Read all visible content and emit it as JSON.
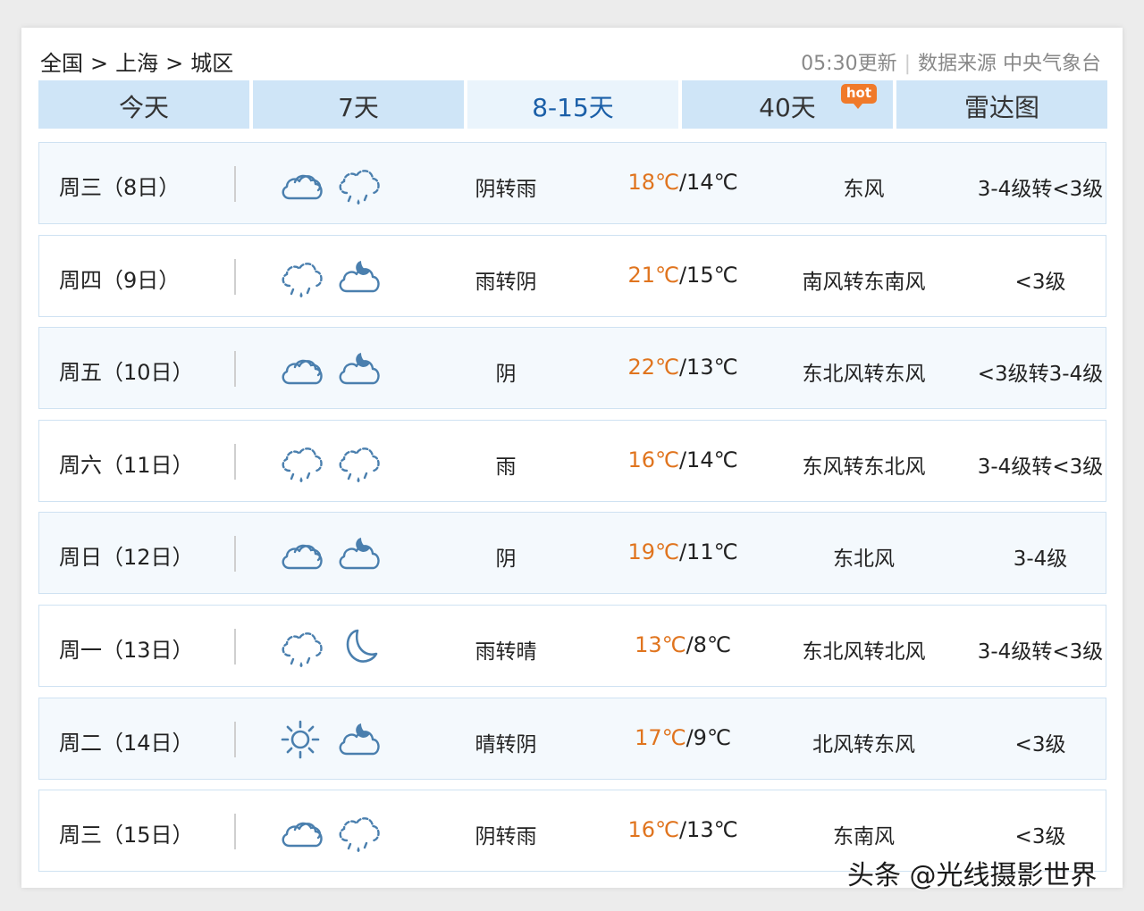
{
  "breadcrumb": {
    "items": [
      "全国",
      "上海",
      "城区"
    ],
    "separator": ">"
  },
  "meta": {
    "update_time": "05:30更新",
    "source": "数据来源 中央气象台"
  },
  "tabs": [
    {
      "label": "今天"
    },
    {
      "label": "7天"
    },
    {
      "label": "8-15天",
      "active": true
    },
    {
      "label": "40天",
      "badge": "hot"
    },
    {
      "label": "雷达图"
    }
  ],
  "forecast": [
    {
      "day": "周三（8日）",
      "icon_day": "cloudy-icon",
      "icon_night": "rain-icon",
      "weather": "阴转雨",
      "high": "18℃",
      "low": "14℃",
      "wind": "东风",
      "level": "3-4级转<3级"
    },
    {
      "day": "周四（9日）",
      "icon_day": "rain-icon",
      "icon_night": "partly-cloudy-night-icon",
      "weather": "雨转阴",
      "high": "21℃",
      "low": "15℃",
      "wind": "南风转东南风",
      "level": "<3级"
    },
    {
      "day": "周五（10日）",
      "icon_day": "cloudy-icon",
      "icon_night": "partly-cloudy-night-icon",
      "weather": "阴",
      "high": "22℃",
      "low": "13℃",
      "wind": "东北风转东风",
      "level": "<3级转3-4级"
    },
    {
      "day": "周六（11日）",
      "icon_day": "rain-icon",
      "icon_night": "rain-icon",
      "weather": "雨",
      "high": "16℃",
      "low": "14℃",
      "wind": "东风转东北风",
      "level": "3-4级转<3级"
    },
    {
      "day": "周日（12日）",
      "icon_day": "cloudy-icon",
      "icon_night": "partly-cloudy-night-icon",
      "weather": "阴",
      "high": "19℃",
      "low": "11℃",
      "wind": "东北风",
      "level": "3-4级"
    },
    {
      "day": "周一（13日）",
      "icon_day": "rain-icon",
      "icon_night": "moon-icon",
      "weather": "雨转晴",
      "high": "13℃",
      "low": "8℃",
      "wind": "东北风转北风",
      "level": "3-4级转<3级"
    },
    {
      "day": "周二（14日）",
      "icon_day": "sun-icon",
      "icon_night": "partly-cloudy-night-icon",
      "weather": "晴转阴",
      "high": "17℃",
      "low": "9℃",
      "wind": "北风转东风",
      "level": "<3级"
    },
    {
      "day": "周三（15日）",
      "icon_day": "cloudy-icon",
      "icon_night": "rain-icon",
      "weather": "阴转雨",
      "high": "16℃",
      "low": "13℃",
      "wind": "东南风",
      "level": "<3级"
    }
  ],
  "colors": {
    "accent": "#1b5fa8",
    "tab_bg": "#cfe5f7",
    "high_temp": "#e0741e",
    "icon": "#4a7fae"
  },
  "watermark": "头条 @光线摄影世界"
}
